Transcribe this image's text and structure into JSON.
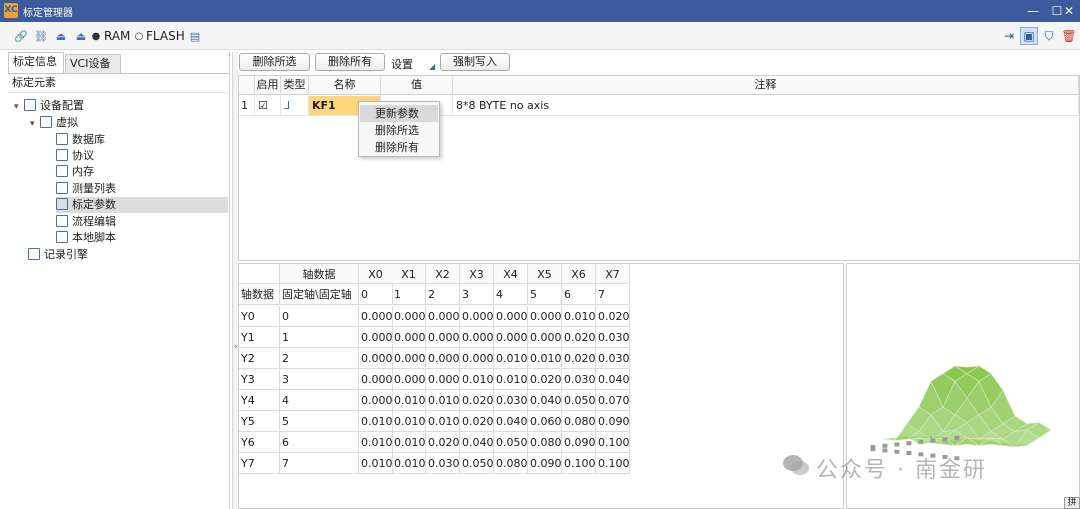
{
  "window": {
    "title": "标定管理器",
    "logo": "XC",
    "minimize": "—",
    "maximize": "☐",
    "close": "✕"
  },
  "toolbar": {
    "ram_label": "RAM",
    "flash_label": "FLASH"
  },
  "left": {
    "tabs": [
      "标定信息",
      "VCI设备"
    ],
    "tree_header": "标定元素",
    "tree": [
      {
        "label": "设备配置"
      },
      {
        "label": "虚拟"
      },
      {
        "label": "数据库"
      },
      {
        "label": "协议"
      },
      {
        "label": "内存"
      },
      {
        "label": "测量列表"
      },
      {
        "label": "标定参数"
      },
      {
        "label": "流程编辑"
      },
      {
        "label": "本地脚本"
      },
      {
        "label": "记录引擎"
      }
    ]
  },
  "buttons": {
    "delete_selected": "删除所选",
    "delete_all": "删除所有",
    "settings": "设置",
    "force_write": "强制写入"
  },
  "param_table": {
    "headers": [
      "启用",
      "类型",
      "名称",
      "值",
      "注释"
    ],
    "rows": [
      {
        "index": "1",
        "enabled": "☑",
        "name": "KF1",
        "value": "",
        "comment": "8*8 BYTE no axis"
      }
    ]
  },
  "context_menu": {
    "items": [
      "更新参数",
      "删除所选",
      "删除所有"
    ]
  },
  "grid": {
    "axis_title": "轴数据",
    "x_headers": [
      "X0",
      "X1",
      "X2",
      "X3",
      "X4",
      "X5",
      "X6",
      "X7"
    ],
    "axis_row_label": "轴数据",
    "axis_row_desc": "固定轴\\固定轴",
    "x_axis_values": [
      "0",
      "1",
      "2",
      "3",
      "4",
      "5",
      "6",
      "7"
    ],
    "rows": [
      {
        "label": "Y0",
        "axis": "0",
        "values": [
          "0.000",
          "0.000",
          "0.000",
          "0.000",
          "0.000",
          "0.000",
          "0.010",
          "0.020"
        ]
      },
      {
        "label": "Y1",
        "axis": "1",
        "values": [
          "0.000",
          "0.000",
          "0.000",
          "0.000",
          "0.000",
          "0.000",
          "0.020",
          "0.030"
        ]
      },
      {
        "label": "Y2",
        "axis": "2",
        "values": [
          "0.000",
          "0.000",
          "0.000",
          "0.000",
          "0.010",
          "0.010",
          "0.020",
          "0.030"
        ]
      },
      {
        "label": "Y3",
        "axis": "3",
        "values": [
          "0.000",
          "0.000",
          "0.000",
          "0.010",
          "0.010",
          "0.020",
          "0.030",
          "0.040"
        ]
      },
      {
        "label": "Y4",
        "axis": "4",
        "values": [
          "0.000",
          "0.010",
          "0.010",
          "0.020",
          "0.030",
          "0.040",
          "0.050",
          "0.070"
        ]
      },
      {
        "label": "Y5",
        "axis": "5",
        "values": [
          "0.010",
          "0.010",
          "0.010",
          "0.020",
          "0.040",
          "0.060",
          "0.080",
          "0.090"
        ]
      },
      {
        "label": "Y6",
        "axis": "6",
        "values": [
          "0.010",
          "0.010",
          "0.020",
          "0.040",
          "0.050",
          "0.080",
          "0.090",
          "0.100"
        ]
      },
      {
        "label": "Y7",
        "axis": "7",
        "values": [
          "0.010",
          "0.010",
          "0.030",
          "0.050",
          "0.080",
          "0.090",
          "0.100",
          "0.100"
        ]
      }
    ]
  },
  "surface": {
    "color": "#7fc241"
  },
  "watermark": {
    "text": "公众号 · 南金研"
  },
  "corner_badge": "拼"
}
